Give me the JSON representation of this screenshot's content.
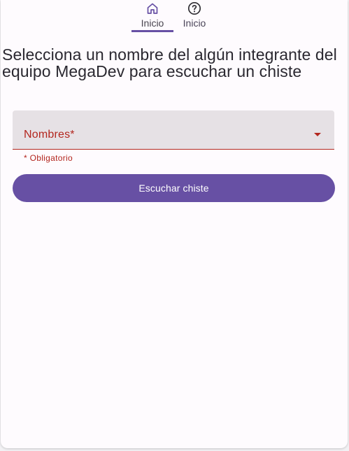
{
  "tabs": [
    {
      "label": "Inicio",
      "icon": "home-icon",
      "selected": true
    },
    {
      "label": "Inicio",
      "icon": "help-circle-icon",
      "selected": false
    }
  ],
  "heading": "Selecciona un nombre del algún integrante del equipo MegaDev para escuchar un chiste",
  "form": {
    "select_label": "Nombres*",
    "helper_text": "* Obligatorio",
    "submit_label": "Escuchar chiste"
  },
  "colors": {
    "primary": "#6750a4",
    "error": "#b3261e",
    "field_bg": "#e6e1e5",
    "surface": "#fefbfe"
  }
}
